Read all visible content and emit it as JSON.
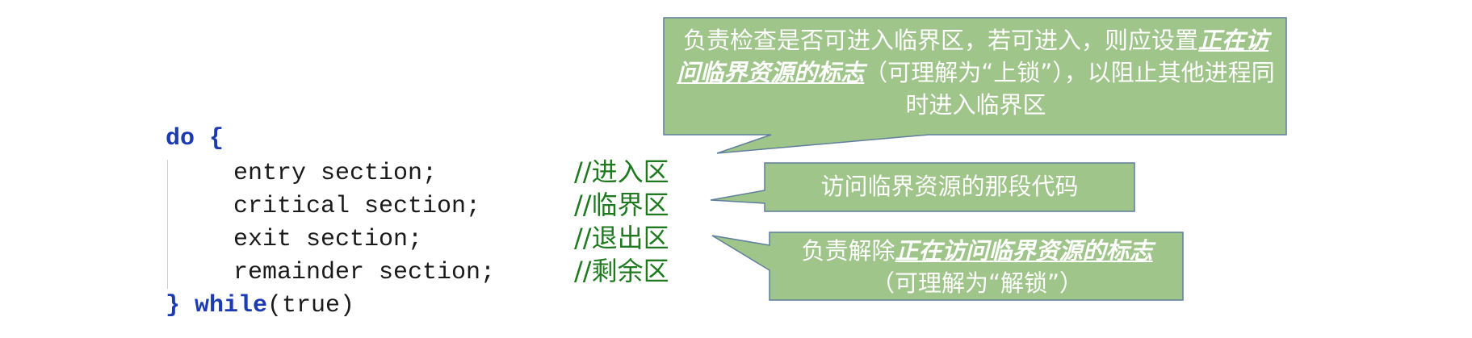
{
  "code": {
    "do_keyword": "do",
    "open_brace": " {",
    "close_brace": "}",
    "while_keyword": "while",
    "while_condition": "(true)",
    "lines": [
      {
        "text": "entry section;",
        "comment": "//进入区"
      },
      {
        "text": "critical section;",
        "comment": "//临界区"
      },
      {
        "text": "exit section;",
        "comment": "//退出区"
      },
      {
        "text": "remainder section;",
        "comment": "//剩余区"
      }
    ]
  },
  "callouts": {
    "entry": {
      "part1": "负责检查是否可进入临界区，若可进入，则应设置",
      "emphasis": "正在访问临界资源的标志",
      "part2": "（可理解为“上锁”），以阻止其他进程同时进入临界区"
    },
    "critical": {
      "text": "访问临界资源的那段代码"
    },
    "exit": {
      "part1": "负责解除",
      "emphasis": "正在访问临界资源的标志",
      "part2": "（可理解为“解锁”）"
    }
  },
  "colors": {
    "callout_fill": "#9fc58a",
    "callout_stroke": "#5f7f9c",
    "keyword": "#1c3bb0",
    "comment": "#1f7a1f"
  }
}
